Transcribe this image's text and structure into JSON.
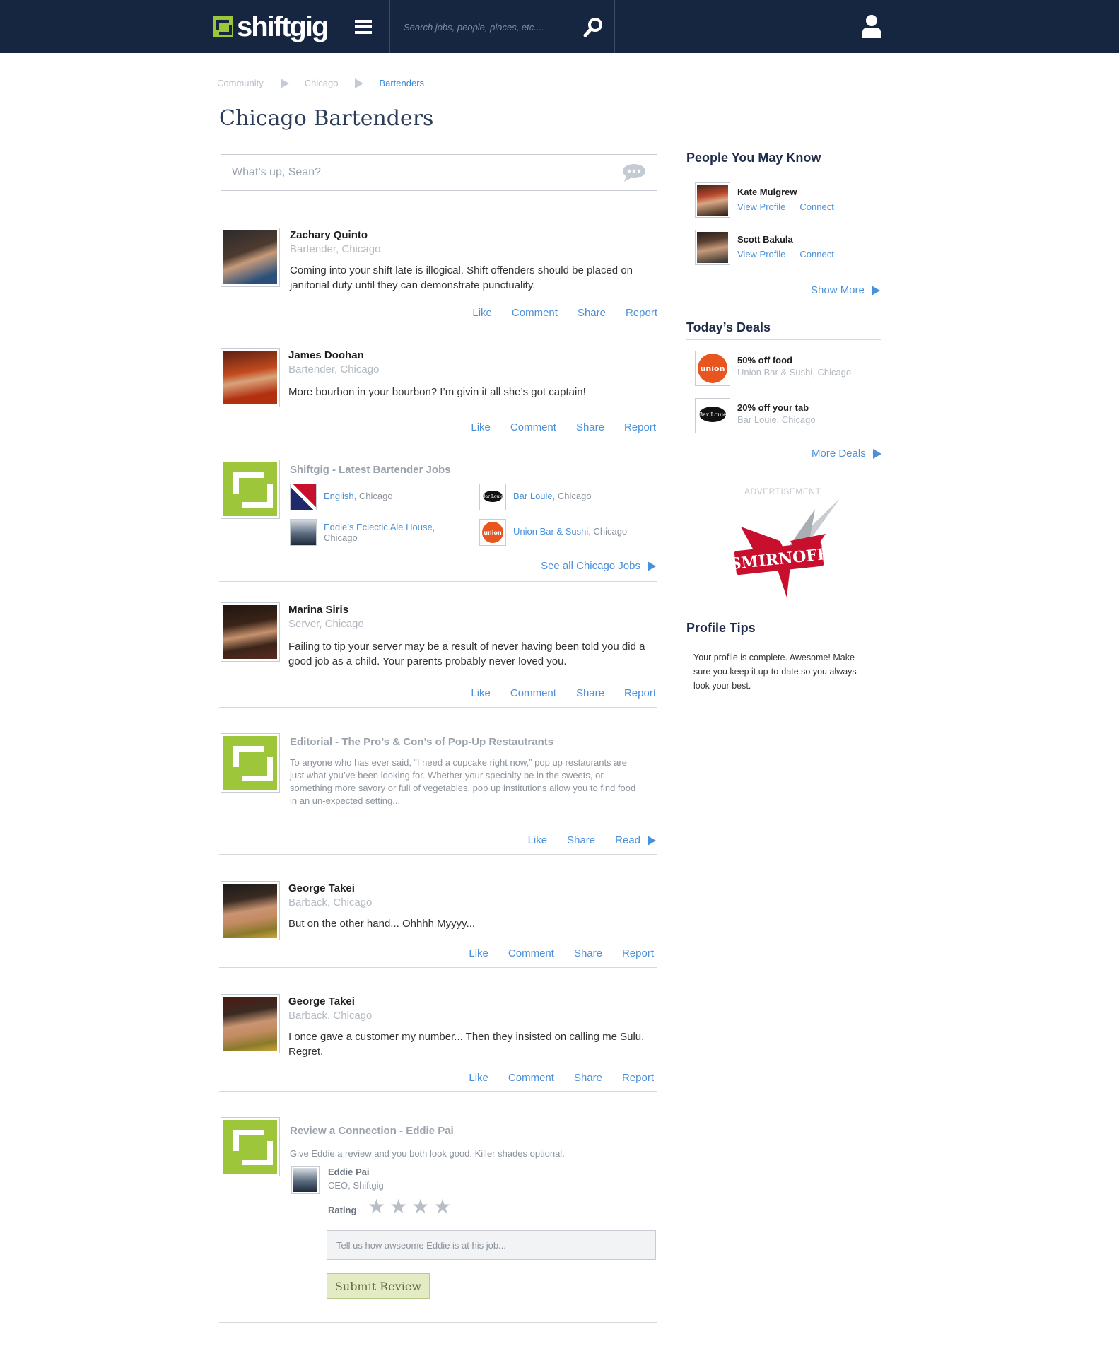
{
  "header": {
    "brand": "shiftgig",
    "search_placeholder": "Search jobs, people, places, etc...."
  },
  "breadcrumb": [
    "Community",
    "Chicago",
    "Bartenders"
  ],
  "page_title": "Chicago Bartenders",
  "composer": {
    "placeholder": "What’s up, Sean?"
  },
  "actions": {
    "like": "Like",
    "comment": "Comment",
    "share": "Share",
    "report": "Report",
    "read": "Read"
  },
  "posts": [
    {
      "name": "Zachary Quinto",
      "role": "Bartender, Chicago",
      "text": "Coming into your shift late is illogical. Shift offenders should be placed on janitorial duty until they can demonstrate punctuality."
    },
    {
      "name": "James Doohan",
      "role": "Bartender, Chicago",
      "text": "More bourbon in your bourbon? I’m givin it all she’s got captain!"
    },
    {
      "name": "Marina Siris",
      "role": "Server, Chicago",
      "text": "Failing to tip your server may be a result of never having been told you did a good job as a child. Your parents probably never loved you."
    },
    {
      "name": "George Takei",
      "role": "Barback, Chicago",
      "text": "But on the other hand... Ohhhh Myyyy..."
    },
    {
      "name": "George Takei",
      "role": "Barback, Chicago",
      "text": "I once gave a customer my number... Then they insisted on calling me Sulu. Regret."
    }
  ],
  "jobs_card": {
    "title": "Shiftgig - Latest Bartender Jobs",
    "jobs": [
      {
        "place": "English",
        "city": ", Chicago"
      },
      {
        "place": "Bar Louie",
        "city": ", Chicago"
      },
      {
        "place": "Eddie’s Eclectic Ale House,",
        "city": "Chicago"
      },
      {
        "place": "Union  Bar & Sushi",
        "city": ", Chicago"
      }
    ],
    "see_all": "See all Chicago Jobs"
  },
  "editorial": {
    "title": "Editorial - The Pro’s & Con’s of Pop-Up Restautrants",
    "text": "To anyone who has ever said, “I need a cupcake right now,” pop up restaurants are just what you’ve been looking for. Whether your specialty be in the sweets, or something more savory or full of vegetables, pop up institutions allow you to find food in an un-expected setting..."
  },
  "review": {
    "title": "Review a Connection - Eddie Pai",
    "intro": "Give Eddie a review and you both look good. Killer shades optional.",
    "person_name": "Eddie Pai",
    "person_role": "CEO, Shiftgig",
    "rating_label": "Rating",
    "rating": 0,
    "max_rating": 4,
    "input_placeholder": "Tell us how awseome Eddie is at his job...",
    "submit_label": "Submit Review"
  },
  "sidebar": {
    "people_title": "People You May Know",
    "people": [
      {
        "name": "Kate Mulgrew",
        "view": "View Profile",
        "connect": "Connect"
      },
      {
        "name": "Scott Bakula",
        "view": "View Profile",
        "connect": "Connect"
      }
    ],
    "show_more": "Show More",
    "deals_title": "Today’s Deals",
    "deals": [
      {
        "offer": "50% off food",
        "place": "Union Bar & Sushi, Chicago"
      },
      {
        "offer": "20% off your tab",
        "place": "Bar Louie, Chicago"
      }
    ],
    "more_deals": "More Deals",
    "ad_label": "ADVERTISEMENT",
    "ad_brand": "SMIRNOFF",
    "tips_title": "Profile Tips",
    "tips_text": "Your profile is complete. Awesome! Make sure you keep it up-to-date so you always look your best."
  },
  "colors": {
    "navbar": "#172640",
    "brand_green": "#9dc63b",
    "link": "#4a90d9",
    "muted": "#b3b9c1"
  }
}
